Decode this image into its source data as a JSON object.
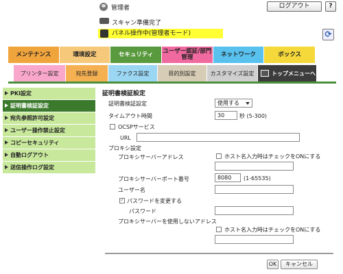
{
  "header": {
    "admin_label": "管理者",
    "logout_label": "ログアウト",
    "help_label": "?",
    "scan_status": "スキャン準備完了",
    "panel_status": "パネル操作中(管理者モード)",
    "refresh_icon": "⟳"
  },
  "main_tabs": [
    {
      "label": "メンテナンス",
      "color": "#f0a43c"
    },
    {
      "label": "環境設定",
      "color": "#f5c87a"
    },
    {
      "label": "セキュリティ",
      "color": "#5a9a3e"
    },
    {
      "label": "ユーザー認証/部門管理",
      "color": "#f06aa0"
    },
    {
      "label": "ネットワーク",
      "color": "#58c1ee"
    },
    {
      "label": "ボックス",
      "color": "#f5d83a"
    }
  ],
  "sub_tabs": [
    {
      "label": "プリンター設定",
      "color": "#f9a8cc"
    },
    {
      "label": "宛先登録",
      "color": "#f5b052"
    },
    {
      "label": "ファクス設定",
      "color": "#9bd6f2"
    },
    {
      "label": "目的別設定",
      "color": "#d7ccb5"
    },
    {
      "label": "カスタマイズ設定",
      "color": "#cfcfcf"
    },
    {
      "label": "トップメニューへ",
      "color": "#3c3c3c"
    }
  ],
  "sidebar": {
    "items": [
      {
        "label": "PKI設定",
        "active": false
      },
      {
        "label": "証明書検証設定",
        "active": true
      },
      {
        "label": "宛先参照許可設定",
        "active": false
      },
      {
        "label": "ユーザー操作禁止設定",
        "active": false
      },
      {
        "label": "コピーセキュリティ",
        "active": false
      },
      {
        "label": "自動ログアウト",
        "active": false
      },
      {
        "label": "送信操作ログ設定",
        "active": false
      }
    ]
  },
  "form": {
    "title": "証明書検証設定",
    "cert_verify_label": "証明書検証設定",
    "cert_verify_value": "使用する",
    "timeout_label": "タイムアウト時間",
    "timeout_value": "30",
    "timeout_unit": "秒 (5-300)",
    "ocsp_label": "OCSPサービス",
    "ocsp_checked": false,
    "url_label": "URL",
    "url_value": "",
    "proxy_label": "プロキシ設定",
    "proxy_address_label": "プロキシサーバーアドレス",
    "host_input_label": "ホスト名入力時はチェックをONにする",
    "proxy_address_value": "",
    "proxy_port_label": "プロキシサーバーポート番号",
    "proxy_port_value": "8080",
    "proxy_port_range": "(1-65535)",
    "username_label": "ユーザー名",
    "username_value": "",
    "change_password_label": "パスワードを変更する",
    "change_password_checked": true,
    "password_label": "パスワード",
    "password_value": "",
    "no_proxy_label": "プロキシサーバーを使用しないアドレス",
    "host_input_label_2": "ホスト名入力時はチェックをONにする",
    "no_proxy_value": ""
  },
  "buttons": {
    "ok": "OK",
    "cancel": "キャンセル"
  },
  "colors": {
    "accent_green": "#3b7a2c",
    "sidebar_bg": "#c8e89c",
    "panel_yellow": "#ffff33"
  }
}
